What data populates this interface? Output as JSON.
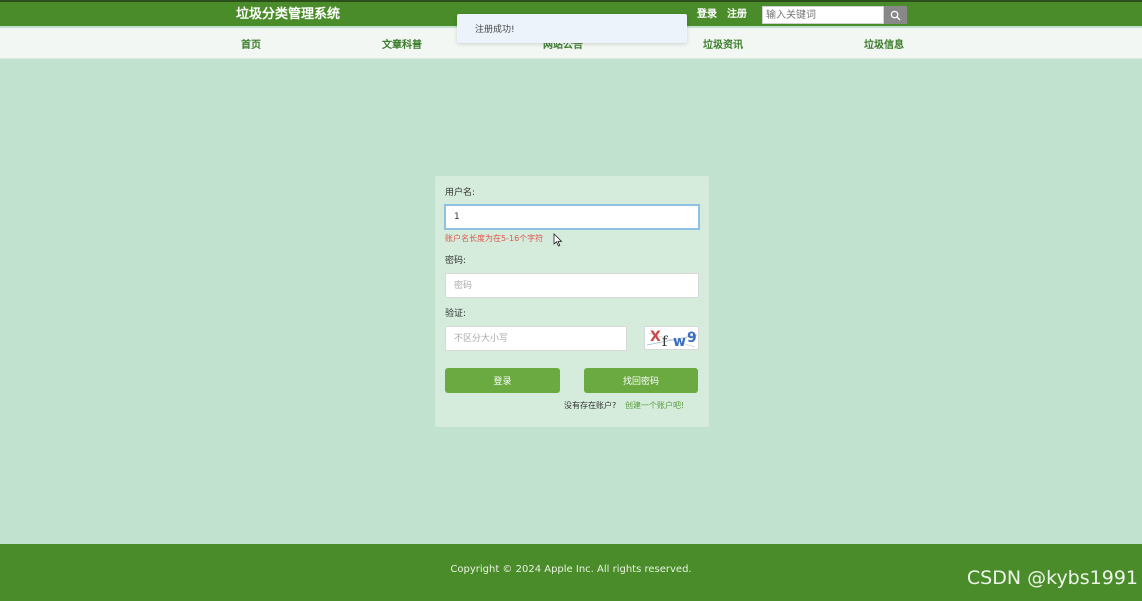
{
  "header": {
    "site_title": "垃圾分类管理系统",
    "login_link": "登录",
    "register_link": "注册",
    "search_placeholder": "输入关键词"
  },
  "nav": {
    "items": [
      {
        "label": "首页"
      },
      {
        "label": "文章科普"
      },
      {
        "label": "网站公告"
      },
      {
        "label": "垃圾资讯"
      },
      {
        "label": "垃圾信息"
      }
    ]
  },
  "toast": {
    "message": "注册成功!"
  },
  "login_form": {
    "username_label": "用户名:",
    "username_value": "1",
    "username_error": "账户名长度为在5-16个字符",
    "password_label": "密码:",
    "password_placeholder": "密码",
    "captcha_label": "验证:",
    "captcha_placeholder": "不区分大小写",
    "captcha_text": "Xfw9",
    "login_button": "登录",
    "forgot_button": "找回密码",
    "no_account_text": "没有存在账户?",
    "create_account_link": "创建一个账户吧!"
  },
  "footer": {
    "copyright": "Copyright © 2024 Apple Inc. All rights reserved."
  },
  "watermark": "CSDN @kybs1991",
  "colors": {
    "header_green": "#4a8c2a",
    "background": "#c1e2ce",
    "button_green": "#6aaa41",
    "error_red": "#e0554a"
  }
}
